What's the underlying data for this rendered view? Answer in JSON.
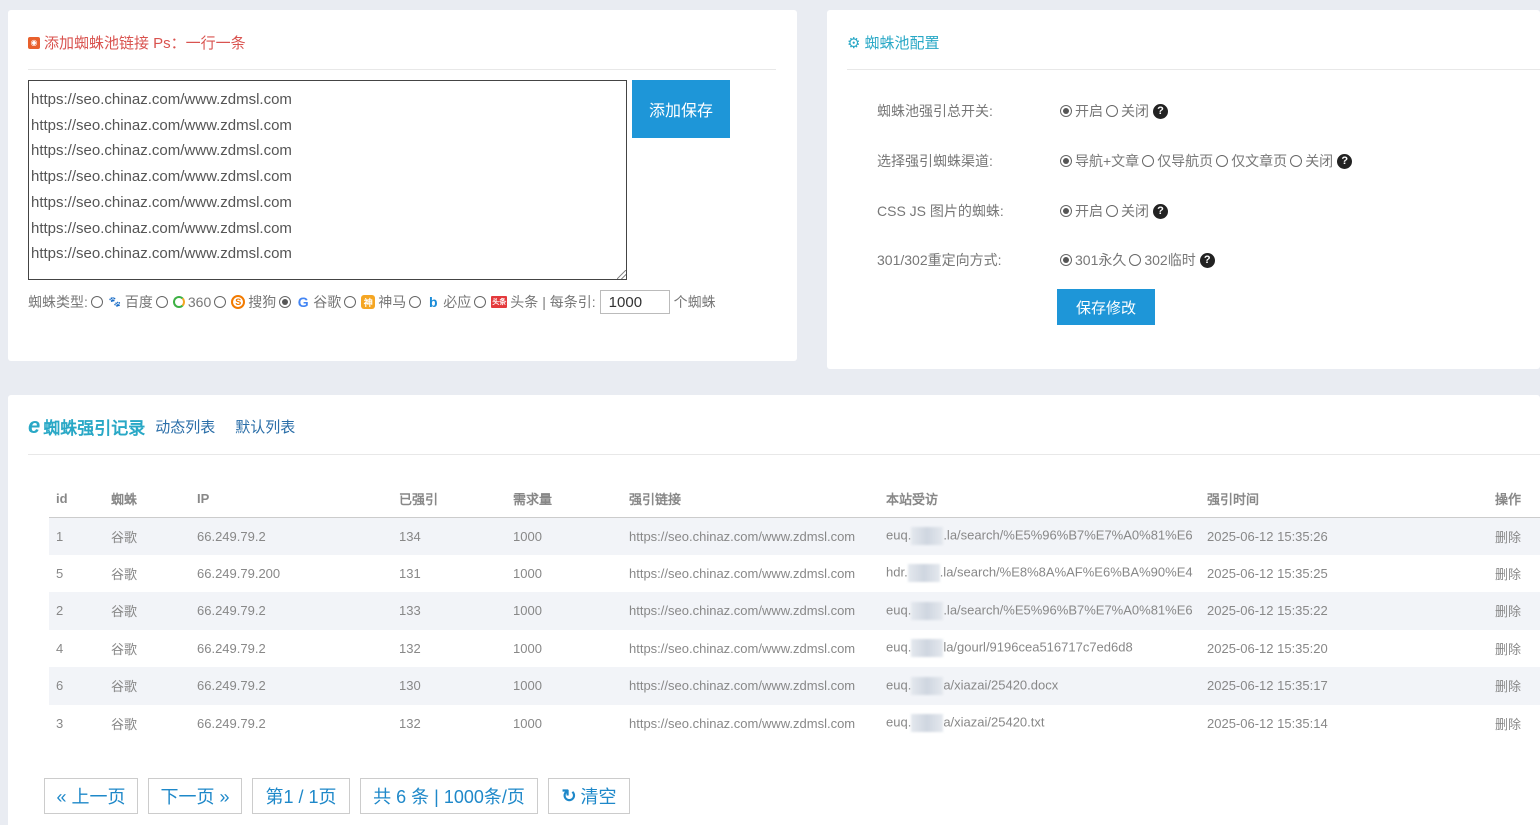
{
  "add_panel": {
    "title": "添加蜘蛛池链接 Ps：一行一条",
    "icon": "rss-icon",
    "links_text": "https://seo.chinaz.com/www.zdmsl.com\nhttps://seo.chinaz.com/www.zdmsl.com\nhttps://seo.chinaz.com/www.zdmsl.com\nhttps://seo.chinaz.com/www.zdmsl.com\nhttps://seo.chinaz.com/www.zdmsl.com\nhttps://seo.chinaz.com/www.zdmsl.com\nhttps://seo.chinaz.com/www.zdmsl.com",
    "save_label": "添加保存",
    "spider_type_label": "蜘蛛类型:",
    "spiders": [
      {
        "name": "百度",
        "icon": "baidu-icon",
        "checked": false
      },
      {
        "name": "360",
        "icon": "360-icon",
        "checked": false
      },
      {
        "name": "搜狗",
        "icon": "sogou-icon",
        "checked": false
      },
      {
        "name": "谷歌",
        "icon": "google-icon",
        "checked": true
      },
      {
        "name": "神马",
        "icon": "shenma-icon",
        "checked": false
      },
      {
        "name": "必应",
        "icon": "bing-icon",
        "checked": false
      },
      {
        "name": "头条",
        "icon": "toutiao-icon",
        "checked": false
      }
    ],
    "per_label": "| 每条引:",
    "per_value": "1000",
    "unit_label": "个蜘蛛"
  },
  "config_panel": {
    "title": "蜘蛛池配置",
    "icon": "gears-icon",
    "rows": [
      {
        "label": "蜘蛛池强引总开关:",
        "options": [
          "开启",
          "关闭"
        ],
        "selected": 0
      },
      {
        "label": "选择强引蜘蛛渠道:",
        "options": [
          "导航+文章",
          "仅导航页",
          "仅文章页",
          "关闭"
        ],
        "selected": 0
      },
      {
        "label": "CSS JS 图片的蜘蛛:",
        "options": [
          "开启",
          "关闭"
        ],
        "selected": 0
      },
      {
        "label": "301/302重定向方式:",
        "options": [
          "301永久",
          "302临时"
        ],
        "selected": 0
      }
    ],
    "save_label": "保存修改"
  },
  "log_panel": {
    "title": "蜘蛛强引记录",
    "icon": "ie-icon",
    "tabs": [
      "动态列表",
      "默认列表"
    ],
    "columns": [
      "id",
      "蜘蛛",
      "IP",
      "已强引",
      "需求量",
      "强引链接",
      "本站受访",
      "强引时间",
      "操作"
    ],
    "rows": [
      {
        "id": "1",
        "spider": "谷歌",
        "ip": "66.249.79.2",
        "done": "134",
        "need": "1000",
        "link": "https://seo.chinaz.com/www.zdmsl.com",
        "visit_pre": "euq.",
        "visit_post": ".la/search/%E5%96%B7%E7%A0%81%E6",
        "time": "2025-06-12 15:35:26",
        "op": "删除"
      },
      {
        "id": "5",
        "spider": "谷歌",
        "ip": "66.249.79.200",
        "done": "131",
        "need": "1000",
        "link": "https://seo.chinaz.com/www.zdmsl.com",
        "visit_pre": "hdr.",
        "visit_post": ".la/search/%E8%8A%AF%E6%BA%90%E4",
        "time": "2025-06-12 15:35:25",
        "op": "删除"
      },
      {
        "id": "2",
        "spider": "谷歌",
        "ip": "66.249.79.2",
        "done": "133",
        "need": "1000",
        "link": "https://seo.chinaz.com/www.zdmsl.com",
        "visit_pre": "euq.",
        "visit_post": ".la/search/%E5%96%B7%E7%A0%81%E6",
        "time": "2025-06-12 15:35:22",
        "op": "删除"
      },
      {
        "id": "4",
        "spider": "谷歌",
        "ip": "66.249.79.2",
        "done": "132",
        "need": "1000",
        "link": "https://seo.chinaz.com/www.zdmsl.com",
        "visit_pre": "euq.",
        "visit_post": "la/gourl/9196cea516717c7ed6d8",
        "time": "2025-06-12 15:35:20",
        "op": "删除"
      },
      {
        "id": "6",
        "spider": "谷歌",
        "ip": "66.249.79.2",
        "done": "130",
        "need": "1000",
        "link": "https://seo.chinaz.com/www.zdmsl.com",
        "visit_pre": "euq.",
        "visit_post": "a/xiazai/25420.docx",
        "time": "2025-06-12 15:35:17",
        "op": "删除"
      },
      {
        "id": "3",
        "spider": "谷歌",
        "ip": "66.249.79.2",
        "done": "132",
        "need": "1000",
        "link": "https://seo.chinaz.com/www.zdmsl.com",
        "visit_pre": "euq.",
        "visit_post": "a/xiazai/25420.txt",
        "time": "2025-06-12 15:35:14",
        "op": "删除"
      }
    ],
    "pager": {
      "prev": "« 上一页",
      "next": "下一页 »",
      "page": "第1 / 1页",
      "total": "共 6 条 | 1000条/页",
      "clear": "清空"
    }
  },
  "colors": {
    "accent": "#1e96d8",
    "title_red": "#d9534f",
    "title_teal": "#29a8c6",
    "link": "#2a6ea8",
    "background": "#e9ecf2"
  }
}
